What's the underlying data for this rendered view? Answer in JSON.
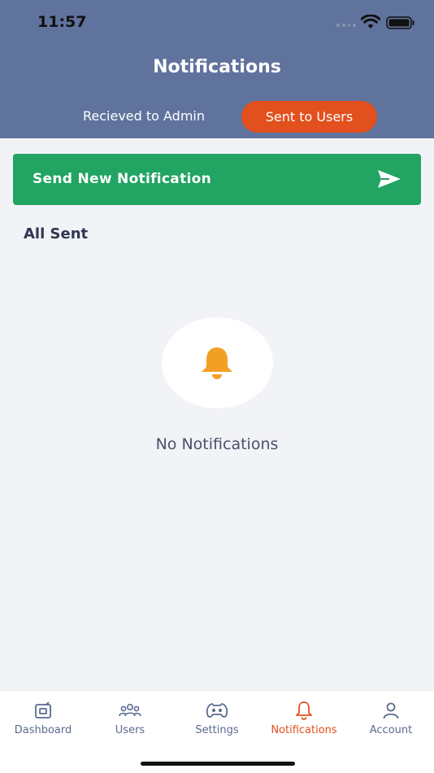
{
  "status_bar": {
    "time": "11:57"
  },
  "header": {
    "title": "Notifications",
    "tabs": [
      {
        "label": "Recieved to Admin",
        "active": false
      },
      {
        "label": "Sent to Users",
        "active": true
      }
    ]
  },
  "send_button": {
    "label": "Send New Notification",
    "icon": "send-icon"
  },
  "section": {
    "title": "All Sent"
  },
  "empty_state": {
    "icon": "bell-icon",
    "text": "No Notifications"
  },
  "tab_bar": {
    "items": [
      {
        "label": "Dashboard",
        "icon": "dashboard-icon",
        "active": false
      },
      {
        "label": "Users",
        "icon": "users-icon",
        "active": false
      },
      {
        "label": "Settings",
        "icon": "settings-icon",
        "active": false
      },
      {
        "label": "Notifications",
        "icon": "bell-icon",
        "active": true
      },
      {
        "label": "Account",
        "icon": "account-icon",
        "active": false
      }
    ]
  },
  "colors": {
    "header_bg": "#5f739d",
    "accent": "#e2501e",
    "send_button_bg": "#22a462",
    "bell": "#f2a024",
    "page_bg": "#f2f3f7"
  }
}
